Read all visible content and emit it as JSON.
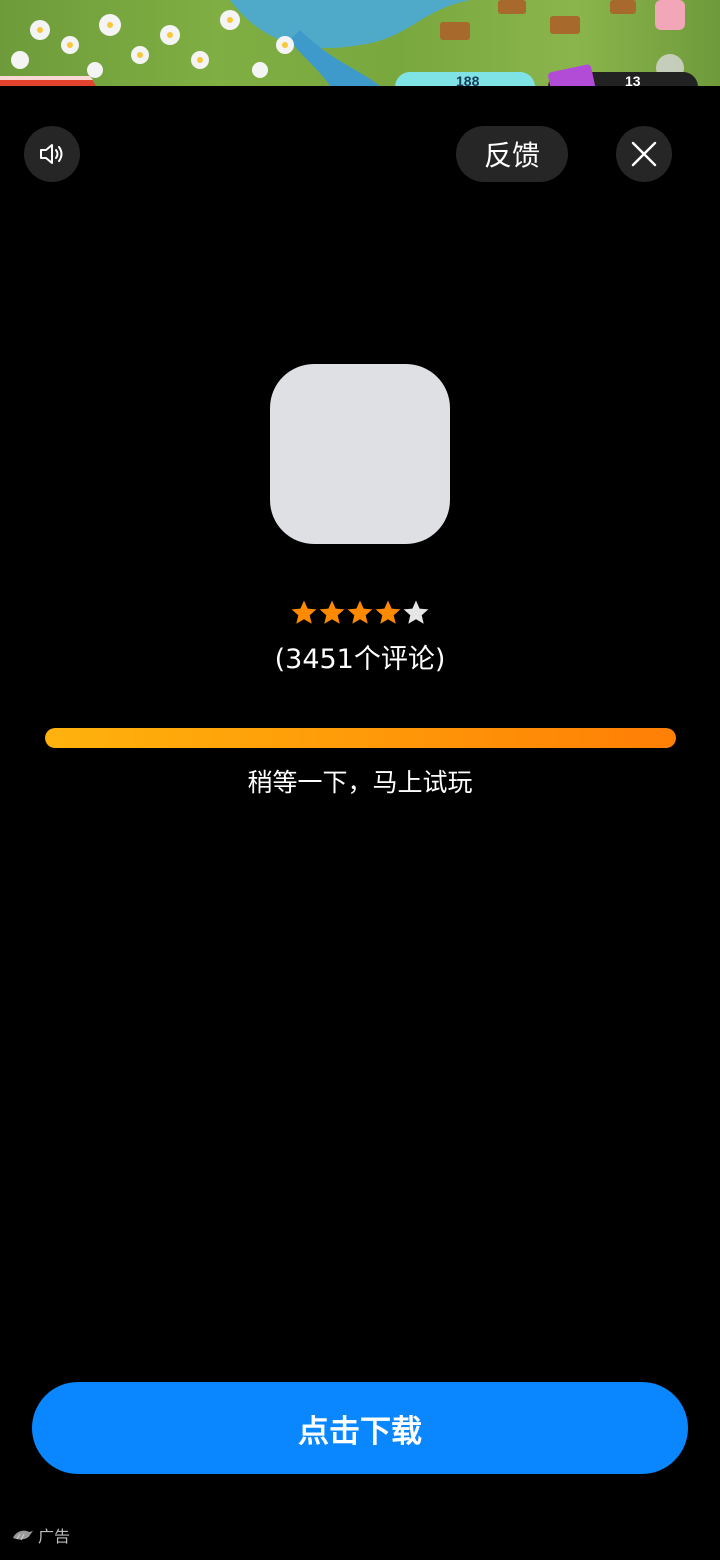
{
  "header": {
    "sound_icon": "speaker-icon",
    "feedback_label": "反馈",
    "close_icon": "close-icon"
  },
  "app": {
    "rating": 4,
    "rating_max": 5,
    "reviews_text": "(3451个评论)"
  },
  "progress": {
    "percent": 100,
    "status_text": "稍等一下，马上试玩"
  },
  "cta": {
    "download_label": "点击下载"
  },
  "ad": {
    "label": "广告",
    "logo_icon": "bird-logo-icon"
  },
  "colors": {
    "background": "#000000",
    "button_blue": "#0a86ff",
    "progress_start": "#ffb20d",
    "progress_end": "#ff7f05",
    "star_filled": "#ff8a00",
    "star_empty": "#e6e6e6",
    "control_bg": "#262626"
  }
}
